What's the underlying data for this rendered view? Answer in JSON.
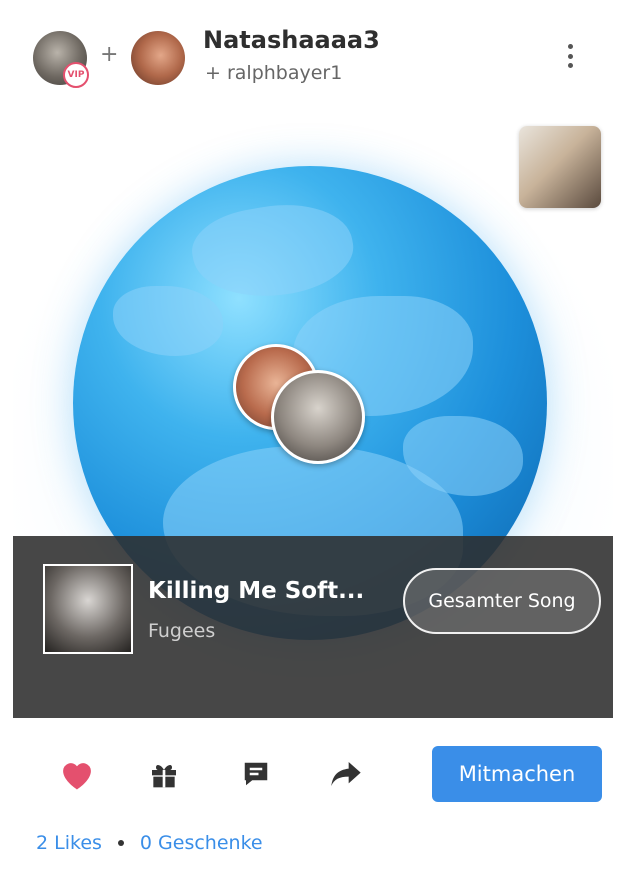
{
  "header": {
    "vip_badge": "VIP",
    "plus_sign": "+",
    "username": "Natashaaaa3",
    "partner": "+ ralphbayer1"
  },
  "song": {
    "title": "Killing Me Soft...",
    "artist": "Fugees",
    "full_song_label": "Gesamter Song"
  },
  "actions": {
    "join_label": "Mitmachen",
    "icons": [
      "heart-icon",
      "gift-icon",
      "comment-icon",
      "share-icon"
    ]
  },
  "stats": {
    "likes": "2 Likes",
    "gifts": "0 Geschenke"
  },
  "colors": {
    "accent_blue": "#3a8ee8",
    "heart_pink": "#e4506e",
    "overlay_dark": "#2d2d2d"
  }
}
